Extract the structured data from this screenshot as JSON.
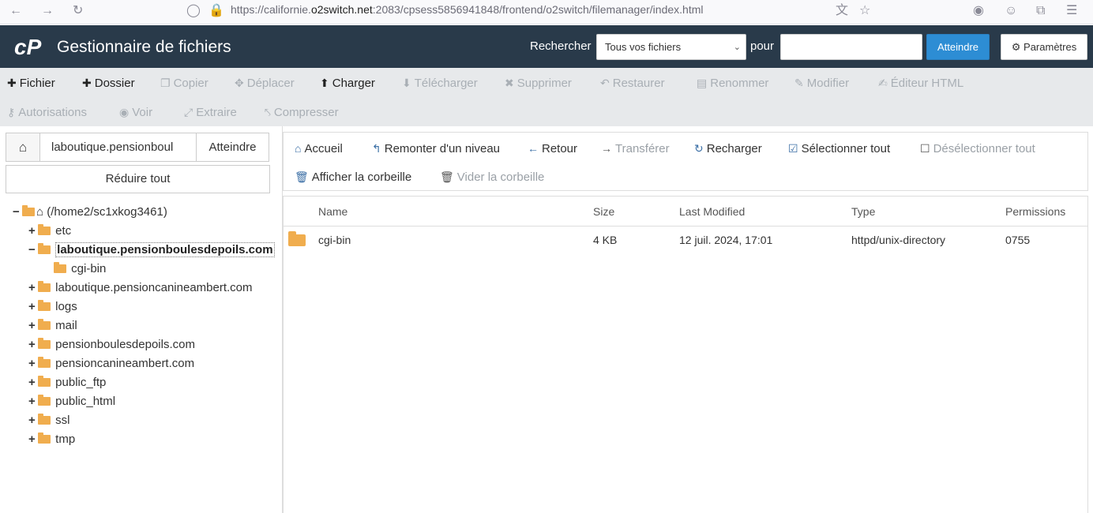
{
  "browser": {
    "url_prefix": "https://californie.",
    "url_domain": "o2switch.net",
    "url_suffix": ":2083/cpsess5856941848/frontend/o2switch/filemanager/index.html"
  },
  "header": {
    "title": "Gestionnaire de fichiers",
    "search_label": "Rechercher",
    "search_scope": "Tous vos fichiers",
    "for_label": "pour",
    "search_value": "",
    "go_label": "Atteindre",
    "settings_label": "Paramètres",
    "brand_color": "#293a4a",
    "accent_color": "#2d8dd4"
  },
  "toolbar": {
    "file": "Fichier",
    "folder": "Dossier",
    "copy": "Copier",
    "move": "Déplacer",
    "upload": "Charger",
    "download": "Télécharger",
    "delete": "Supprimer",
    "restore": "Restaurer",
    "rename": "Renommer",
    "edit": "Modifier",
    "html_editor": "Éditeur HTML",
    "permissions": "Autorisations",
    "view": "Voir",
    "extract": "Extraire",
    "compress": "Compresser"
  },
  "sidebar": {
    "path_value": "laboutique.pensionboul",
    "go_label": "Atteindre",
    "collapse_label": "Réduire tout",
    "root": "(/home2/sc1xkog3461)",
    "items": [
      {
        "label": "etc"
      },
      {
        "label": "laboutique.pensionboulesdepoils.com"
      },
      {
        "label": "cgi-bin"
      },
      {
        "label": "laboutique.pensioncanineambert.com"
      },
      {
        "label": "logs"
      },
      {
        "label": "mail"
      },
      {
        "label": "pensionboulesdepoils.com"
      },
      {
        "label": "pensioncanineambert.com"
      },
      {
        "label": "public_ftp"
      },
      {
        "label": "public_html"
      },
      {
        "label": "ssl"
      },
      {
        "label": "tmp"
      }
    ]
  },
  "navbar": {
    "home": "Accueil",
    "up": "Remonter d'un niveau",
    "back": "Retour",
    "forward": "Transférer",
    "reload": "Recharger",
    "select_all": "Sélectionner tout",
    "deselect_all": "Désélectionner tout",
    "show_trash": "Afficher la corbeille",
    "empty_trash": "Vider la corbeille"
  },
  "table": {
    "columns": [
      "Name",
      "Size",
      "Last Modified",
      "Type",
      "Permissions"
    ],
    "rows": [
      {
        "name": "cgi-bin",
        "size": "4 KB",
        "modified": "12 juil. 2024, 17:01",
        "type": "httpd/unix-directory",
        "perms": "0755"
      }
    ]
  }
}
